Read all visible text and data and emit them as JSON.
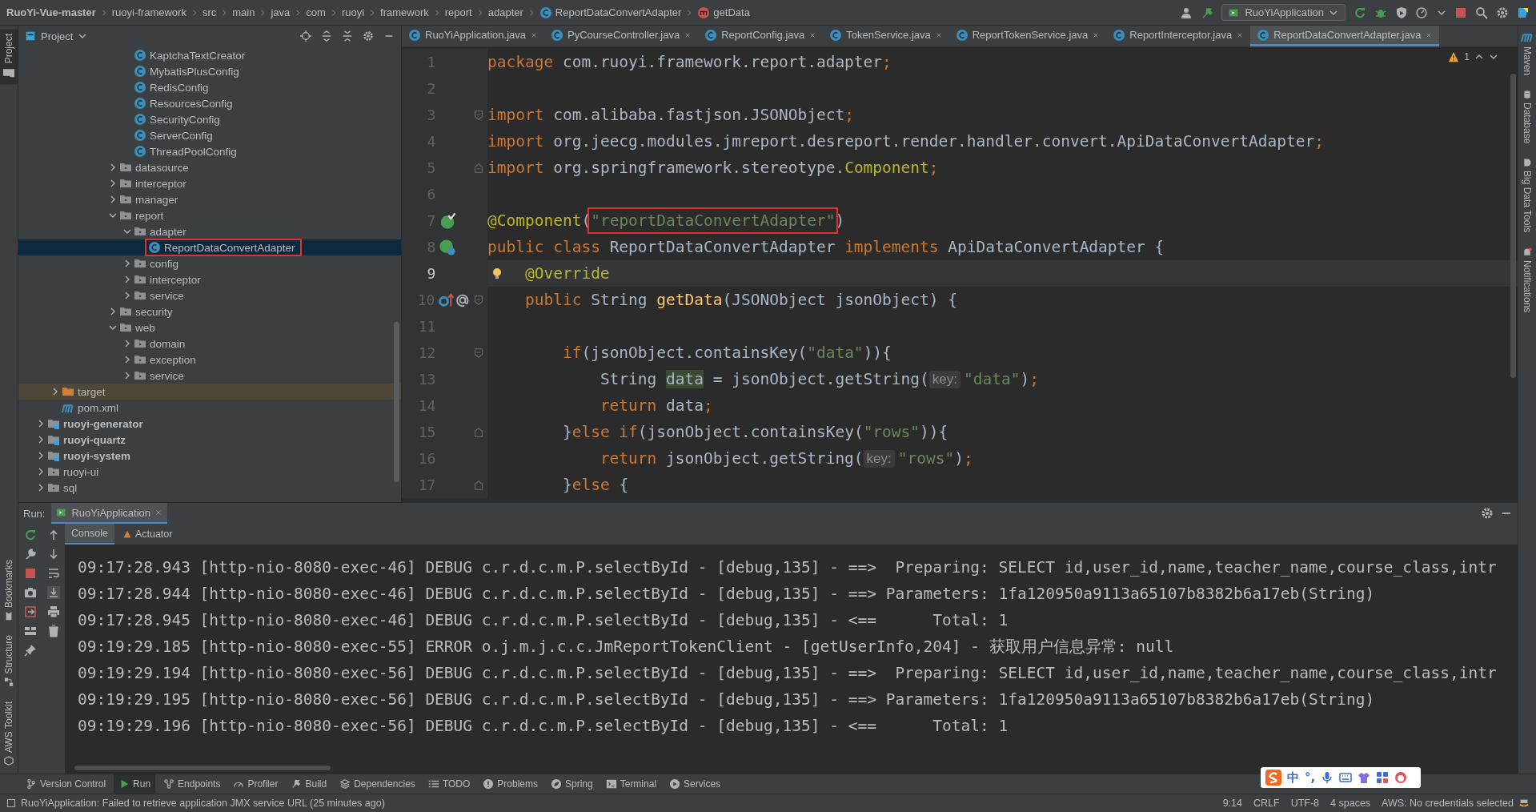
{
  "navbar": {
    "breadcrumbs": [
      {
        "label": "RuoYi-Vue-master",
        "kind": "project"
      },
      {
        "label": "ruoyi-framework",
        "kind": "module"
      },
      {
        "label": "src",
        "kind": "folder"
      },
      {
        "label": "main",
        "kind": "folder"
      },
      {
        "label": "java",
        "kind": "folder"
      },
      {
        "label": "com",
        "kind": "folder"
      },
      {
        "label": "ruoyi",
        "kind": "folder"
      },
      {
        "label": "framework",
        "kind": "folder"
      },
      {
        "label": "report",
        "kind": "folder"
      },
      {
        "label": "adapter",
        "kind": "folder"
      },
      {
        "label": "ReportDataConvertAdapter",
        "kind": "class"
      },
      {
        "label": "getData",
        "kind": "method"
      }
    ],
    "run_config": "RuoYiApplication"
  },
  "left_strip": {
    "top": [
      {
        "label": "Project",
        "selected": true
      }
    ],
    "bottom": [
      {
        "label": "Bookmarks"
      },
      {
        "label": "Structure"
      },
      {
        "label": "AWS Toolkit"
      }
    ]
  },
  "project_panel": {
    "title": "Project",
    "tree": [
      {
        "children": [
          {
            "children": [
              {
                "children": [
                  {
                    "children": [
                      {
                        "children": [
                          {
                            "children": [
                              {
                                "label": "KaptchaTextCreator",
                                "kind": "class",
                                "selected": false
                              },
                              {
                                "label": "MybatisPlusConfig",
                                "kind": "class",
                                "selected": false
                              },
                              {
                                "label": "RedisConfig",
                                "kind": "class",
                                "selected": false
                              },
                              {
                                "label": "ResourcesConfig",
                                "kind": "class",
                                "selected": false
                              },
                              {
                                "label": "SecurityConfig",
                                "kind": "class",
                                "selected": false
                              },
                              {
                                "label": "ServerConfig",
                                "kind": "class",
                                "selected": false
                              },
                              {
                                "label": "ThreadPoolConfig",
                                "kind": "class",
                                "selected": false
                              }
                            ]
                          },
                          {
                            "label": "datasource",
                            "kind": "folder",
                            "expanded": false,
                            "selected": false
                          },
                          {
                            "label": "interceptor",
                            "kind": "folder",
                            "expanded": false,
                            "selected": false
                          },
                          {
                            "label": "manager",
                            "kind": "folder",
                            "expanded": false,
                            "selected": false
                          },
                          {
                            "label": "report",
                            "kind": "folder",
                            "expanded": true,
                            "selected": false,
                            "children": [
                              {
                                "label": "adapter",
                                "kind": "folder",
                                "expanded": true,
                                "selected": false,
                                "children": [
                                  {
                                    "label": "ReportDataConvertAdapter",
                                    "kind": "class",
                                    "selected": true,
                                    "annotated": true
                                  }
                                ]
                              },
                              {
                                "label": "config",
                                "kind": "folder",
                                "expanded": false,
                                "selected": false
                              },
                              {
                                "label": "interceptor",
                                "kind": "folder",
                                "expanded": false,
                                "selected": false
                              },
                              {
                                "label": "service",
                                "kind": "folder",
                                "expanded": false,
                                "selected": false
                              }
                            ]
                          },
                          {
                            "label": "security",
                            "kind": "folder",
                            "expanded": false,
                            "selected": false
                          },
                          {
                            "label": "web",
                            "kind": "folder",
                            "expanded": true,
                            "selected": false,
                            "children": [
                              {
                                "label": "domain",
                                "kind": "folder",
                                "expanded": false,
                                "selected": false
                              },
                              {
                                "label": "exception",
                                "kind": "folder",
                                "expanded": false,
                                "selected": false
                              },
                              {
                                "label": "service",
                                "kind": "folder",
                                "expanded": false,
                                "selected": false
                              }
                            ]
                          }
                        ]
                      }
                    ]
                  }
                ]
              }
            ]
          },
          {
            "label": "target",
            "kind": "excluded",
            "expanded": false,
            "selected": false
          },
          {
            "label": "pom.xml",
            "kind": "maven",
            "selected": false
          }
        ]
      },
      {
        "label": "ruoyi-generator",
        "kind": "module",
        "expanded": false,
        "selected": false
      },
      {
        "label": "ruoyi-quartz",
        "kind": "module",
        "expanded": false,
        "selected": false
      },
      {
        "label": "ruoyi-system",
        "kind": "module",
        "expanded": false,
        "selected": false
      },
      {
        "label": "ruoyi-ui",
        "kind": "folder",
        "expanded": false,
        "selected": false
      },
      {
        "label": "sql",
        "kind": "folder",
        "expanded": false,
        "selected": false
      }
    ]
  },
  "editor": {
    "tabs": [
      {
        "label": "RuoYiApplication.java",
        "selected": false
      },
      {
        "label": "PyCourseController.java",
        "selected": false
      },
      {
        "label": "ReportConfig.java",
        "selected": false
      },
      {
        "label": "TokenService.java",
        "selected": false
      },
      {
        "label": "ReportTokenService.java",
        "selected": false
      },
      {
        "label": "ReportInterceptor.java",
        "selected": false
      },
      {
        "label": "ReportDataConvertAdapter.java",
        "selected": true
      }
    ],
    "warnings": "1",
    "lines": [
      {
        "no": "1",
        "tokens": [
          {
            "t": "package ",
            "kind": "kw"
          },
          {
            "t": "com.ruoyi.framework.report.adapter",
            "kind": "plain"
          },
          {
            "t": ";",
            "kind": "kw"
          }
        ]
      },
      {
        "no": "2"
      },
      {
        "no": "3",
        "fold": {
          "kind": "start"
        },
        "tokens": [
          {
            "t": "import ",
            "kind": "kw"
          },
          {
            "t": "com.alibaba.fastjson.JSONObject",
            "kind": "plain"
          },
          {
            "t": ";",
            "kind": "kw"
          }
        ]
      },
      {
        "no": "4",
        "tokens": [
          {
            "t": "import ",
            "kind": "kw"
          },
          {
            "t": "org.jeecg.modules.jmreport.desreport.render.handler.convert.ApiDataConvertAdapter",
            "kind": "plain"
          },
          {
            "t": ";",
            "kind": "kw"
          }
        ]
      },
      {
        "no": "5",
        "fold": {
          "kind": "end"
        },
        "tokens": [
          {
            "t": "import ",
            "kind": "kw"
          },
          {
            "t": "org.springframework.stereotype.",
            "kind": "plain"
          },
          {
            "t": "Component",
            "kind": "ann"
          },
          {
            "t": ";",
            "kind": "kw"
          }
        ]
      },
      {
        "no": "6"
      },
      {
        "no": "7",
        "gutter": {
          "kind": "bean"
        },
        "tokens": [
          {
            "t": "@Component",
            "kind": "ann"
          },
          {
            "t": "(",
            "kind": "plain"
          },
          {
            "t": "\"reportDataConvertAdapter\"",
            "kind": "str",
            "boxed": true
          },
          {
            "t": ")",
            "kind": "plain"
          }
        ]
      },
      {
        "no": "8",
        "gutter": {
          "kind": "bean-class"
        },
        "tokens": [
          {
            "t": "public class ",
            "kind": "kw"
          },
          {
            "t": "ReportDataConvertAdapter ",
            "kind": "plain"
          },
          {
            "t": "implements ",
            "kind": "kw"
          },
          {
            "t": "ApiDataConvertAdapter {",
            "kind": "plain"
          }
        ]
      },
      {
        "no": "9",
        "current": true,
        "intention": true,
        "tokens": [
          {
            "t": "@Override",
            "kind": "ann"
          }
        ]
      },
      {
        "no": "10",
        "gutter": {
          "kind": "override"
        },
        "fold": {
          "kind": "start"
        },
        "tokens": [
          {
            "t": "    public ",
            "kind": "kw"
          },
          {
            "t": "String ",
            "kind": "plain"
          },
          {
            "t": "getData",
            "kind": "fn"
          },
          {
            "t": "(JSONObject jsonObject) {",
            "kind": "plain"
          }
        ]
      },
      {
        "no": "11"
      },
      {
        "no": "12",
        "fold": {
          "kind": "start"
        },
        "tokens": [
          {
            "t": "        if",
            "kind": "kw"
          },
          {
            "t": "(jsonObject.containsKey(",
            "kind": "plain"
          },
          {
            "t": "\"data\"",
            "kind": "str"
          },
          {
            "t": ")){",
            "kind": "plain"
          }
        ]
      },
      {
        "no": "13",
        "tokens": [
          {
            "t": "            String ",
            "kind": "plain"
          },
          {
            "t": "data",
            "kind": "var"
          },
          {
            "t": " = jsonObject.getString(",
            "kind": "plain"
          },
          {
            "t": "key:",
            "kind": "hint"
          },
          {
            "t": "\"data\"",
            "kind": "str"
          },
          {
            "t": ")",
            "kind": "plain"
          },
          {
            "t": ";",
            "kind": "kw"
          }
        ]
      },
      {
        "no": "14",
        "tokens": [
          {
            "t": "            return ",
            "kind": "kw"
          },
          {
            "t": "data",
            "kind": "plain"
          },
          {
            "t": ";",
            "kind": "kw"
          }
        ]
      },
      {
        "no": "15",
        "fold": {
          "kind": "mid"
        },
        "tokens": [
          {
            "t": "        }",
            "kind": "plain"
          },
          {
            "t": "else if",
            "kind": "kw"
          },
          {
            "t": "(jsonObject.containsKey(",
            "kind": "plain"
          },
          {
            "t": "\"rows\"",
            "kind": "str"
          },
          {
            "t": ")){",
            "kind": "plain"
          }
        ]
      },
      {
        "no": "16",
        "tokens": [
          {
            "t": "            return ",
            "kind": "kw"
          },
          {
            "t": "jsonObject.getString(",
            "kind": "plain"
          },
          {
            "t": "key:",
            "kind": "hint"
          },
          {
            "t": "\"rows\"",
            "kind": "str"
          },
          {
            "t": ")",
            "kind": "plain"
          },
          {
            "t": ";",
            "kind": "kw"
          }
        ]
      },
      {
        "no": "17",
        "fold": {
          "kind": "mid"
        },
        "tokens": [
          {
            "t": "        }",
            "kind": "plain"
          },
          {
            "t": "else ",
            "kind": "kw"
          },
          {
            "t": "{",
            "kind": "plain"
          }
        ]
      }
    ]
  },
  "right_strip": [
    {
      "label": "Maven",
      "kind": "maven"
    },
    {
      "label": "Database",
      "kind": "database"
    },
    {
      "label": "Big Data Tools",
      "kind": "bigdata"
    },
    {
      "label": "Notifications",
      "kind": "bell"
    }
  ],
  "run_panel": {
    "label": "Run:",
    "tab": "RuoYiApplication",
    "subtabs": [
      {
        "label": "Console",
        "selected": true
      },
      {
        "label": "Actuator",
        "selected": false
      }
    ],
    "console": [
      "09:17:28.943 [http-nio-8080-exec-46] DEBUG c.r.d.c.m.P.selectById - [debug,135] - ==>  Preparing: SELECT id,user_id,name,teacher_name,course_class,intr",
      "09:17:28.944 [http-nio-8080-exec-46] DEBUG c.r.d.c.m.P.selectById - [debug,135] - ==> Parameters: 1fa120950a9113a65107b8382b6a17eb(String)",
      "09:17:28.945 [http-nio-8080-exec-46] DEBUG c.r.d.c.m.P.selectById - [debug,135] - <==      Total: 1",
      "09:19:29.185 [http-nio-8080-exec-55] ERROR o.j.m.j.c.c.JmReportTokenClient - [getUserInfo,204] - 获取用户信息异常: null",
      "09:19:29.194 [http-nio-8080-exec-56] DEBUG c.r.d.c.m.P.selectById - [debug,135] - ==>  Preparing: SELECT id,user_id,name,teacher_name,course_class,intr",
      "09:19:29.195 [http-nio-8080-exec-56] DEBUG c.r.d.c.m.P.selectById - [debug,135] - ==> Parameters: 1fa120950a9113a65107b8382b6a17eb(String)",
      "09:19:29.196 [http-nio-8080-exec-56] DEBUG c.r.d.c.m.P.selectById - [debug,135] - <==      Total: 1"
    ]
  },
  "tool_windows": [
    {
      "label": "Version Control",
      "kind": "vcs",
      "selected": false
    },
    {
      "label": "Run",
      "kind": "run",
      "selected": true
    },
    {
      "label": "Endpoints",
      "kind": "endpoints",
      "selected": false
    },
    {
      "label": "Profiler",
      "kind": "profiler",
      "selected": false
    },
    {
      "label": "Build",
      "kind": "build",
      "selected": false
    },
    {
      "label": "Dependencies",
      "kind": "dependencies",
      "selected": false
    },
    {
      "label": "TODO",
      "kind": "todo",
      "selected": false
    },
    {
      "label": "Problems",
      "kind": "problems",
      "selected": false
    },
    {
      "label": "Spring",
      "kind": "spring",
      "selected": false
    },
    {
      "label": "Terminal",
      "kind": "terminal",
      "selected": false
    },
    {
      "label": "Services",
      "kind": "services",
      "selected": false
    }
  ],
  "status_bar": {
    "message": "RuoYiApplication: Failed to retrieve application JMX service URL (25 minutes ago)",
    "items": [
      "9:14",
      "CRLF",
      "UTF-8",
      "4 spaces",
      "AWS: No credentials selected"
    ]
  },
  "ime_toolbar": {
    "mode": "中",
    "punctuation": "°,"
  }
}
